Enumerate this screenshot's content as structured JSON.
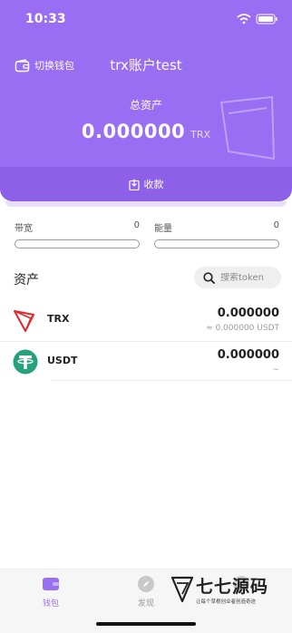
{
  "status_bar": {
    "time": "10:33"
  },
  "header": {
    "switch_wallet": "切换钱包",
    "wallet_name": "trx账户test",
    "total_label": "总资产",
    "total_value": "0.000000",
    "total_unit": "TRX",
    "receive": "收款"
  },
  "resources": {
    "bandwidth": {
      "label": "带宽",
      "value": "0"
    },
    "energy": {
      "label": "能量",
      "value": "0"
    }
  },
  "assets": {
    "title": "资产",
    "search_placeholder": "搜索token",
    "items": [
      {
        "symbol": "TRX",
        "amount": "0.000000",
        "fiat": "≈ 0.000000  USDT",
        "icon": "tron-logo-icon"
      },
      {
        "symbol": "USDT",
        "amount": "0.000000",
        "fiat": "~",
        "icon": "tether-logo-icon"
      }
    ]
  },
  "tabbar": {
    "items": [
      {
        "label": "钱包",
        "icon": "wallet-icon",
        "active": true
      },
      {
        "label": "发现",
        "icon": "compass-icon",
        "active": false
      },
      {
        "label": "我的",
        "icon": "profile-icon",
        "active": false
      }
    ]
  },
  "watermark": {
    "title": "七七源码",
    "subtitle": "让每个草根创业者创造奇迹"
  },
  "colors": {
    "primary": "#9a6ef2",
    "receive_bar": "#8e60e8",
    "tron_red": "#e0282f",
    "tether_green": "#26a17b"
  }
}
